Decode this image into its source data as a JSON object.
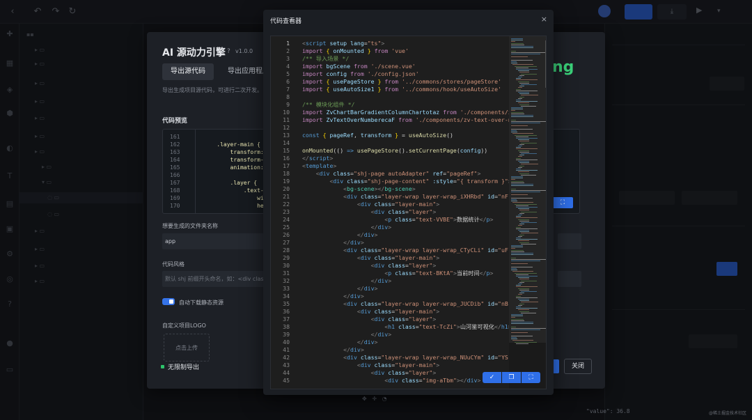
{
  "engine": {
    "title": "AI 源动力引擎",
    "help": "?",
    "version": "v1.0.0",
    "tabs": [
      "导出源代码",
      "导出应用程序"
    ],
    "description": "导出生成项目源代码，可进行二次开发。",
    "logo_text": "ng",
    "preview_title": "代码预览",
    "preview_lines": [
      {
        "n": "161",
        "code": ""
      },
      {
        "n": "162",
        "code": "    .layer-main {"
      },
      {
        "n": "163",
        "code": "        transform:"
      },
      {
        "n": "164",
        "code": "        transform-c"
      },
      {
        "n": "165",
        "code": "        animation:"
      },
      {
        "n": "166",
        "code": ""
      },
      {
        "n": "167",
        "code": "        .layer {"
      },
      {
        "n": "168",
        "code": "            .text-E"
      },
      {
        "n": "169",
        "code": "                wid"
      },
      {
        "n": "170",
        "code": "                hei"
      }
    ],
    "folder_label": "想要生成的文件夹名称",
    "folder_value": "app",
    "style_label": "代码风格",
    "style_placeholder": "默认 shj 前缀开头命名，如：<div class",
    "auto_download_label": "自动下载静态资源",
    "logo_label": "自定义项目LOGO",
    "upload_label": "点击上传",
    "unlimited_label": "无限制导出",
    "close_label": "关闭",
    "expand_icon": "expand-icon"
  },
  "viewer": {
    "title": "代码查看器",
    "close": "×",
    "tool_icons": [
      "check-icon",
      "copy-icon",
      "fullscreen-icon"
    ]
  },
  "code_lines": [
    {
      "n": "1",
      "html": "<span class='p'>&lt;</span><span class='k'>script</span> <span class='a'>setup</span> <span class='a'>lang</span>=<span class='s'>\"ts\"</span><span class='p'>&gt;</span>"
    },
    {
      "n": "2",
      "html": "<span class='m'>import</span> <span class='y'>{</span> <span class='a'>onMounted</span> <span class='y'>}</span> <span class='m'>from</span> <span class='s'>'vue'</span>"
    },
    {
      "n": "3",
      "html": "<span class='c'>/** 导入场景 */</span>"
    },
    {
      "n": "4",
      "html": "<span class='m'>import</span> <span class='a'>bgScene</span> <span class='m'>from</span> <span class='s'>'./scene.vue'</span>"
    },
    {
      "n": "5",
      "html": "<span class='m'>import</span> <span class='a'>config</span> <span class='m'>from</span> <span class='s'>'./config.json'</span>"
    },
    {
      "n": "6",
      "html": "<span class='m'>import</span> <span class='y'>{</span> <span class='a'>usePageStore</span> <span class='y'>}</span> <span class='m'>from</span> <span class='s'>'../commons/stores/pageStore'</span>"
    },
    {
      "n": "7",
      "html": "<span class='m'>import</span> <span class='y'>{</span> <span class='a'>useAutoSize1</span> <span class='y'>}</span> <span class='m'>from</span> <span class='s'>'../commons/hook/useAutoSize'</span>"
    },
    {
      "n": "8",
      "html": ""
    },
    {
      "n": "9",
      "html": "<span class='c'>/** 模块化组件 */</span>"
    },
    {
      "n": "10",
      "html": "<span class='m'>import</span> <span class='a'>ZvChartBarGradientColumnChartotaz</span> <span class='m'>from</span> <span class='s'>'./components/zv-chart-bar-gradient-column-chart/index.vue'</span>"
    },
    {
      "n": "11",
      "html": "<span class='m'>import</span> <span class='a'>ZvTextOverNumberecaF</span> <span class='m'>from</span> <span class='s'>'./components/zv-text-over-number/index.vue'</span>"
    },
    {
      "n": "12",
      "html": ""
    },
    {
      "n": "13",
      "html": "<span class='k'>const</span> <span class='y'>{</span> <span class='a'>pageRef</span>, <span class='a'>transform</span> <span class='y'>}</span> = <span class='f'>useAutoSize</span>()"
    },
    {
      "n": "14",
      "html": ""
    },
    {
      "n": "15",
      "html": "<span class='f'>onMounted</span>(() <span class='k'>=&gt;</span> <span class='f'>usePageStore</span>().<span class='f'>setCurrentPage</span>(<span class='a'>config</span>))"
    },
    {
      "n": "16",
      "html": "<span class='p'>&lt;/</span><span class='k'>script</span><span class='p'>&gt;</span>"
    },
    {
      "n": "17",
      "html": "<span class='p'>&lt;</span><span class='k'>template</span><span class='p'>&gt;</span>"
    },
    {
      "n": "18",
      "html": "    <span class='p'>&lt;</span><span class='k'>div</span> <span class='a'>class</span>=<span class='s'>\"shj-page autoAdapter\"</span> <span class='a'>ref</span>=<span class='s'>\"pageRef\"</span><span class='p'>&gt;</span>"
    },
    {
      "n": "19",
      "html": "        <span class='p'>&lt;</span><span class='k'>div</span> <span class='a'>class</span>=<span class='s'>\"shj-page-content\"</span> <span class='a'>:style</span>=<span class='s'>\"{ transform }\"</span><span class='p'>&gt;</span>"
    },
    {
      "n": "20",
      "html": "            <span class='p'>&lt;</span><span class='t'>bg-scene</span><span class='p'>&gt;&lt;/</span><span class='t'>bg-scene</span><span class='p'>&gt;</span>"
    },
    {
      "n": "21",
      "html": "            <span class='p'>&lt;</span><span class='k'>div</span> <span class='a'>class</span>=<span class='s'>\"layer-wrap layer-wrap_iXHRbd\"</span> <span class='a'>id</span>=<span class='s'>\"nF\"</span><span class='p'>&gt;</span>"
    },
    {
      "n": "22",
      "html": "                <span class='p'>&lt;</span><span class='k'>div</span> <span class='a'>class</span>=<span class='s'>\"layer-main\"</span><span class='p'>&gt;</span>"
    },
    {
      "n": "23",
      "html": "                    <span class='p'>&lt;</span><span class='k'>div</span> <span class='a'>class</span>=<span class='s'>\"layer\"</span><span class='p'>&gt;</span>"
    },
    {
      "n": "24",
      "html": "                        <span class='p'>&lt;</span><span class='k'>p</span> <span class='a'>class</span>=<span class='s'>\"text-VVBE\"</span><span class='p'>&gt;</span>数据统计<span class='p'>&lt;/</span><span class='k'>p</span><span class='p'>&gt;</span>"
    },
    {
      "n": "25",
      "html": "                    <span class='p'>&lt;/</span><span class='k'>div</span><span class='p'>&gt;</span>"
    },
    {
      "n": "26",
      "html": "                <span class='p'>&lt;/</span><span class='k'>div</span><span class='p'>&gt;</span>"
    },
    {
      "n": "27",
      "html": "            <span class='p'>&lt;/</span><span class='k'>div</span><span class='p'>&gt;</span>"
    },
    {
      "n": "28",
      "html": "            <span class='p'>&lt;</span><span class='k'>div</span> <span class='a'>class</span>=<span class='s'>\"layer-wrap layer-wrap_CTyCLi\"</span> <span class='a'>id</span>=<span class='s'>\"uF\"</span><span class='p'>&gt;</span>"
    },
    {
      "n": "29",
      "html": "                <span class='p'>&lt;</span><span class='k'>div</span> <span class='a'>class</span>=<span class='s'>\"layer-main\"</span><span class='p'>&gt;</span>"
    },
    {
      "n": "30",
      "html": "                    <span class='p'>&lt;</span><span class='k'>div</span> <span class='a'>class</span>=<span class='s'>\"layer\"</span><span class='p'>&gt;</span>"
    },
    {
      "n": "31",
      "html": "                        <span class='p'>&lt;</span><span class='k'>p</span> <span class='a'>class</span>=<span class='s'>\"text-BKtA\"</span><span class='p'>&gt;</span>当前时间<span class='p'>&lt;/</span><span class='k'>p</span><span class='p'>&gt;</span>"
    },
    {
      "n": "32",
      "html": "                    <span class='p'>&lt;/</span><span class='k'>div</span><span class='p'>&gt;</span>"
    },
    {
      "n": "33",
      "html": "                <span class='p'>&lt;/</span><span class='k'>div</span><span class='p'>&gt;</span>"
    },
    {
      "n": "34",
      "html": "            <span class='p'>&lt;/</span><span class='k'>div</span><span class='p'>&gt;</span>"
    },
    {
      "n": "35",
      "html": "            <span class='p'>&lt;</span><span class='k'>div</span> <span class='a'>class</span>=<span class='s'>\"layer-wrap layer-wrap_JUCDib\"</span> <span class='a'>id</span>=<span class='s'>\"nB\"</span><span class='p'>&gt;</span>"
    },
    {
      "n": "36",
      "html": "                <span class='p'>&lt;</span><span class='k'>div</span> <span class='a'>class</span>=<span class='s'>\"layer-main\"</span><span class='p'>&gt;</span>"
    },
    {
      "n": "37",
      "html": "                    <span class='p'>&lt;</span><span class='k'>div</span> <span class='a'>class</span>=<span class='s'>\"layer\"</span><span class='p'>&gt;</span>"
    },
    {
      "n": "38",
      "html": "                        <span class='p'>&lt;</span><span class='k'>h1</span> <span class='a'>class</span>=<span class='s'>\"text-TcZi\"</span><span class='p'>&gt;</span>山河鉴可视化<span class='p'>&lt;/</span><span class='k'>h1</span><span class='p'>&gt;</span>"
    },
    {
      "n": "39",
      "html": "                    <span class='p'>&lt;/</span><span class='k'>div</span><span class='p'>&gt;</span>"
    },
    {
      "n": "40",
      "html": "                <span class='p'>&lt;/</span><span class='k'>div</span><span class='p'>&gt;</span>"
    },
    {
      "n": "41",
      "html": "            <span class='p'>&lt;/</span><span class='k'>div</span><span class='p'>&gt;</span>"
    },
    {
      "n": "42",
      "html": "            <span class='p'>&lt;</span><span class='k'>div</span> <span class='a'>class</span>=<span class='s'>\"layer-wrap layer-wrap_NUuCYm\"</span> <span class='a'>id</span>=<span class='s'>\"YS\"</span><span class='p'>&gt;</span>"
    },
    {
      "n": "43",
      "html": "                <span class='p'>&lt;</span><span class='k'>div</span> <span class='a'>class</span>=<span class='s'>\"layer-main\"</span><span class='p'>&gt;</span>"
    },
    {
      "n": "44",
      "html": "                    <span class='p'>&lt;</span><span class='k'>div</span> <span class='a'>class</span>=<span class='s'>\"layer\"</span><span class='p'>&gt;</span>"
    },
    {
      "n": "45",
      "html": "                        <span class='p'>&lt;</span><span class='k'>div</span> <span class='a'>class</span>=<span class='s'>\"img-aTbm\"</span><span class='p'>&gt;&lt;/</span><span class='k'>div</span><span class='p'>&gt;</span>"
    }
  ],
  "background": {
    "value_hint": "\"value\": 36.8",
    "watermark": "@稀土掘金技术社区"
  }
}
